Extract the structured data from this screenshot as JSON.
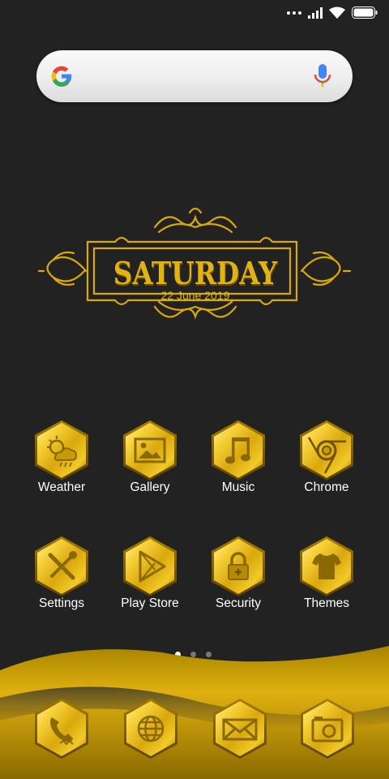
{
  "status_bar": {
    "icons": [
      "signal-dots-icon",
      "signal-bars-icon",
      "wifi-icon",
      "battery-icon"
    ]
  },
  "search": {
    "logo": "google-logo-icon",
    "mic": "microphone-icon"
  },
  "widget": {
    "day": "SATURDAY",
    "date": "22 June 2019"
  },
  "apps": [
    {
      "label": "Weather",
      "icon": "weather-icon"
    },
    {
      "label": "Gallery",
      "icon": "gallery-icon"
    },
    {
      "label": "Music",
      "icon": "music-note-icon"
    },
    {
      "label": "Chrome",
      "icon": "chrome-icon"
    },
    {
      "label": "Settings",
      "icon": "wrench-screwdriver-icon"
    },
    {
      "label": "Play Store",
      "icon": "play-store-icon"
    },
    {
      "label": "Security",
      "icon": "lock-icon"
    },
    {
      "label": "Themes",
      "icon": "tshirt-icon"
    }
  ],
  "dock": [
    {
      "icon": "phone-icon"
    },
    {
      "icon": "globe-icon"
    },
    {
      "icon": "mail-icon"
    },
    {
      "icon": "camera-icon"
    }
  ],
  "pages": {
    "count": 3,
    "active": 1
  },
  "colors": {
    "background": "#222222",
    "gold": "#e1b215",
    "gold_dark": "#8a6a00"
  }
}
